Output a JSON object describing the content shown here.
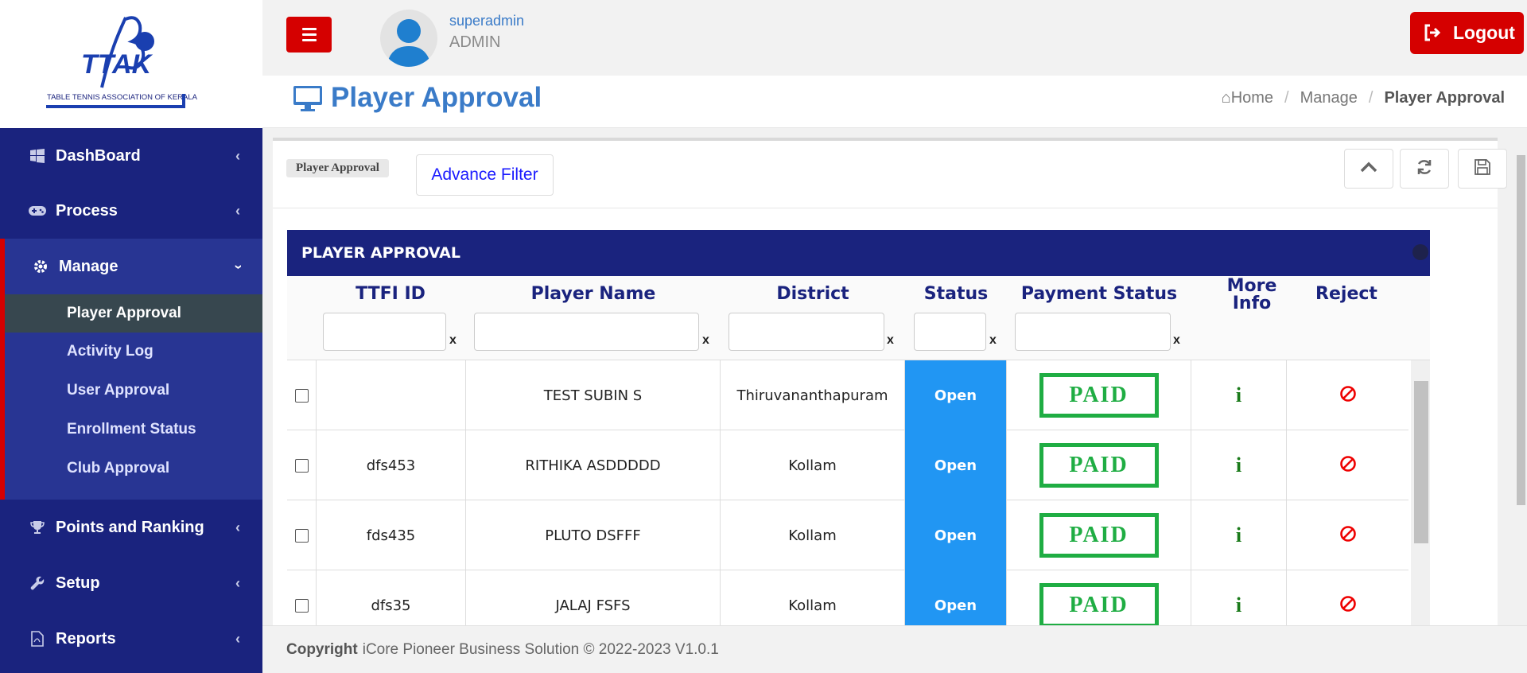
{
  "brand": {
    "logo_text": "TTAK",
    "logo_caption": "TABLE TENNIS ASSOCIATION OF KERALA"
  },
  "colors": {
    "sidebar": "#1a237e",
    "sidebar_active_group": "#283593",
    "accent_red": "#d50000",
    "primary_blue": "#3a7bc8",
    "status_blue": "#2196f3",
    "paid_green": "#1fad43"
  },
  "sidebar": {
    "items": [
      {
        "label": "DashBoard",
        "icon": "windows-icon"
      },
      {
        "label": "Process",
        "icon": "gamepad-icon"
      },
      {
        "label": "Manage",
        "icon": "gear-icon"
      },
      {
        "label": "Points and Ranking",
        "icon": "trophy-icon"
      },
      {
        "label": "Setup",
        "icon": "wrench-icon"
      },
      {
        "label": "Reports",
        "icon": "file-pdf-icon"
      }
    ],
    "manage_sub": [
      "Player Approval",
      "Activity Log",
      "User Approval",
      "Enrollment Status",
      "Club Approval"
    ]
  },
  "topbar": {
    "username": "superadmin",
    "role": "ADMIN",
    "logout_label": "Logout"
  },
  "page": {
    "title": "Player Approval",
    "breadcrumb": [
      "Home",
      "Manage",
      "Player Approval"
    ]
  },
  "panel": {
    "tag": "Player Approval",
    "advance_filter_label": "Advance Filter"
  },
  "grid": {
    "title": "PLAYER APPROVAL",
    "columns": [
      "TTFI ID",
      "Player Name",
      "District",
      "Status",
      "Payment Status",
      "More Info",
      "Reject"
    ],
    "filter_clear": "x",
    "rows": [
      {
        "ttfi_id": "",
        "name": "TEST SUBIN S",
        "district": "Thiruvananthapuram",
        "status": "Open",
        "payment": "PAID",
        "info": "i"
      },
      {
        "ttfi_id": "dfs453",
        "name": "RITHIKA ASDDDDD",
        "district": "Kollam",
        "status": "Open",
        "payment": "PAID",
        "info": "i"
      },
      {
        "ttfi_id": "fds435",
        "name": "PLUTO DSFFF",
        "district": "Kollam",
        "status": "Open",
        "payment": "PAID",
        "info": "i"
      },
      {
        "ttfi_id": "dfs35",
        "name": "JALAJ FSFS",
        "district": "Kollam",
        "status": "Open",
        "payment": "PAID",
        "info": "i"
      }
    ]
  },
  "footer": {
    "copyright_label": "Copyright",
    "text": "iCore Pioneer Business Solution © 2022-2023 V1.0.1"
  }
}
